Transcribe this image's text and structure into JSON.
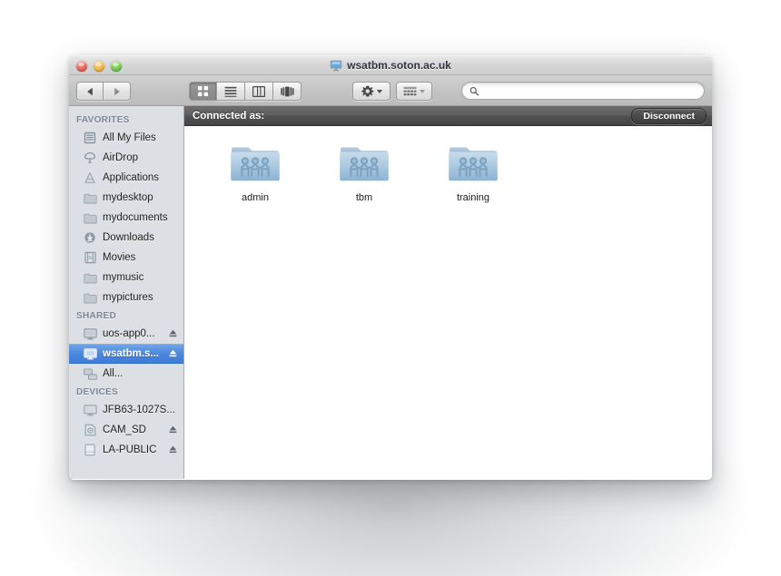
{
  "window": {
    "title": "wsatbm.soton.ac.uk",
    "title_icon": "monitor-icon",
    "traffic_lights": [
      {
        "name": "close",
        "color": "#e8625a"
      },
      {
        "name": "minimize",
        "color": "#efb340"
      },
      {
        "name": "zoom",
        "color": "#74c84c"
      }
    ]
  },
  "toolbar": {
    "back_icon": "back-arrow-icon",
    "forward_icon": "forward-arrow-icon",
    "view_modes": [
      {
        "name": "icon-view",
        "icon": "grid-icon",
        "selected": true
      },
      {
        "name": "list-view",
        "icon": "list-icon",
        "selected": false
      },
      {
        "name": "column-view",
        "icon": "columns-icon",
        "selected": false
      },
      {
        "name": "coverflow-view",
        "icon": "coverflow-icon",
        "selected": false
      }
    ],
    "action_menu": {
      "name": "action-menu",
      "icon": "gear-icon"
    },
    "arrange_menu": {
      "name": "arrange-menu",
      "icon": "arrange-icon"
    }
  },
  "search": {
    "placeholder": "",
    "value": "",
    "icon": "search-icon"
  },
  "sidebar": {
    "sections": [
      {
        "header": "FAVORITES",
        "items": [
          {
            "label": "All My Files",
            "icon": "all-my-files-icon",
            "eject": false,
            "selected": false
          },
          {
            "label": "AirDrop",
            "icon": "airdrop-icon",
            "eject": false,
            "selected": false
          },
          {
            "label": "Applications",
            "icon": "applications-icon",
            "eject": false,
            "selected": false
          },
          {
            "label": "mydesktop",
            "icon": "folder-icon",
            "eject": false,
            "selected": false
          },
          {
            "label": "mydocuments",
            "icon": "folder-icon",
            "eject": false,
            "selected": false
          },
          {
            "label": "Downloads",
            "icon": "downloads-icon",
            "eject": false,
            "selected": false
          },
          {
            "label": "Movies",
            "icon": "movies-icon",
            "eject": false,
            "selected": false
          },
          {
            "label": "mymusic",
            "icon": "folder-icon",
            "eject": false,
            "selected": false
          },
          {
            "label": "mypictures",
            "icon": "folder-icon",
            "eject": false,
            "selected": false
          }
        ]
      },
      {
        "header": "SHARED",
        "items": [
          {
            "label": "uos-app0...",
            "icon": "monitor-icon",
            "eject": true,
            "selected": false
          },
          {
            "label": "wsatbm.s...",
            "icon": "monitor-icon",
            "eject": true,
            "selected": true
          },
          {
            "label": "All...",
            "icon": "network-icon",
            "eject": false,
            "selected": false
          }
        ]
      },
      {
        "header": "DEVICES",
        "items": [
          {
            "label": "JFB63-1027S...",
            "icon": "monitor-icon",
            "eject": false,
            "selected": false
          },
          {
            "label": "CAM_SD",
            "icon": "sdcard-icon",
            "eject": true,
            "selected": false
          },
          {
            "label": "LA-PUBLIC",
            "icon": "drive-icon",
            "eject": true,
            "selected": false
          }
        ]
      }
    ],
    "selection_color": "#4b87dd"
  },
  "content": {
    "connected_bar": {
      "label": "Connected as:",
      "disconnect_label": "Disconnect"
    },
    "files": [
      {
        "name": "admin",
        "icon": "shared-folder-icon"
      },
      {
        "name": "tbm",
        "icon": "shared-folder-icon"
      },
      {
        "name": "training",
        "icon": "shared-folder-icon"
      }
    ]
  }
}
